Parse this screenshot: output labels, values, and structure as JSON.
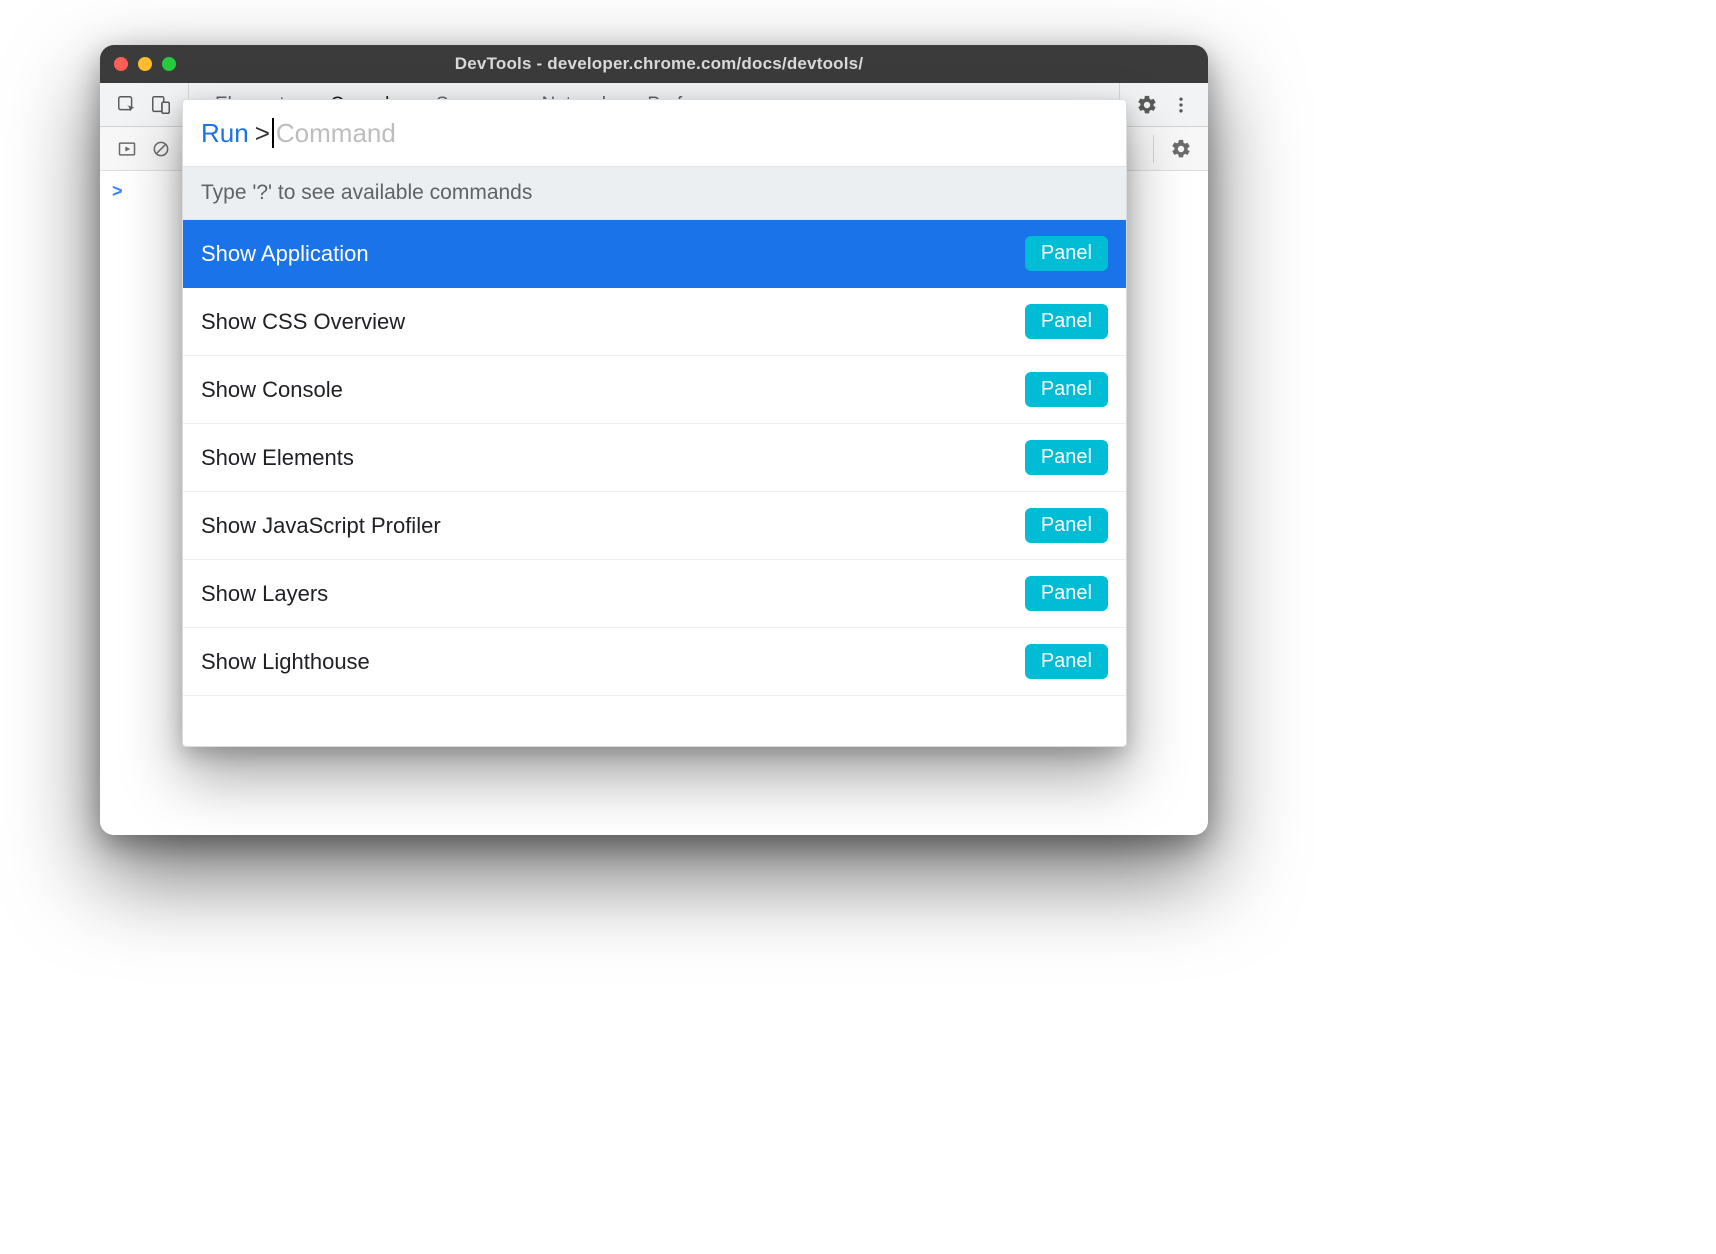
{
  "titlebar": {
    "title": "DevTools - developer.chrome.com/docs/devtools/"
  },
  "toolbar": {
    "tabs": [
      {
        "label": "Elements",
        "active": false
      },
      {
        "label": "Console",
        "active": true
      },
      {
        "label": "Sources",
        "active": false
      },
      {
        "label": "Network",
        "active": false
      },
      {
        "label": "Performance",
        "active": false
      }
    ]
  },
  "console": {
    "prompt": ">"
  },
  "command_menu": {
    "run_label": "Run",
    "chevron": ">",
    "placeholder": "Command",
    "hint": "Type '?' to see available commands",
    "badge_label": "Panel",
    "items": [
      {
        "label": "Show Application",
        "badge": "Panel",
        "selected": true
      },
      {
        "label": "Show CSS Overview",
        "badge": "Panel",
        "selected": false
      },
      {
        "label": "Show Console",
        "badge": "Panel",
        "selected": false
      },
      {
        "label": "Show Elements",
        "badge": "Panel",
        "selected": false
      },
      {
        "label": "Show JavaScript Profiler",
        "badge": "Panel",
        "selected": false
      },
      {
        "label": "Show Layers",
        "badge": "Panel",
        "selected": false
      },
      {
        "label": "Show Lighthouse",
        "badge": "Panel",
        "selected": false
      }
    ]
  }
}
